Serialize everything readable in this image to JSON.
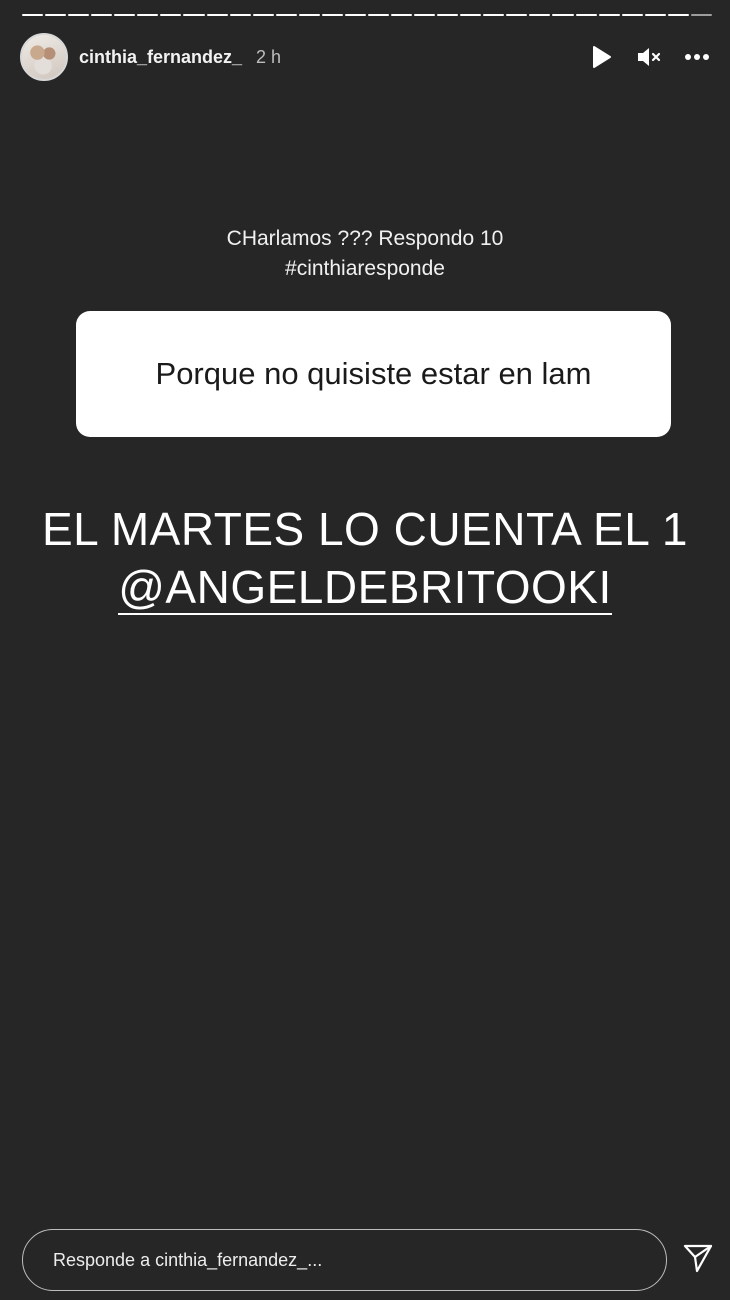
{
  "story": {
    "progress_segments": 30,
    "progress_done": 29
  },
  "header": {
    "username": "cinthia_fernandez_",
    "time": "2 h",
    "icons": [
      "play-icon",
      "mute-icon",
      "more-icon"
    ]
  },
  "question": {
    "header_line1": "CHarlamos ??? Respondo 10",
    "header_line2": "#cinthiaresponde",
    "text": "Porque no quisiste estar en lam"
  },
  "answer": {
    "line1": "EL MARTES LO CUENTA EL 1",
    "mention": "@ANGELDEBRITOOKI"
  },
  "reply": {
    "placeholder": "Responde a cinthia_fernandez_..."
  },
  "colors": {
    "background": "#262626",
    "card": "#ffffff",
    "text": "#ffffff"
  }
}
